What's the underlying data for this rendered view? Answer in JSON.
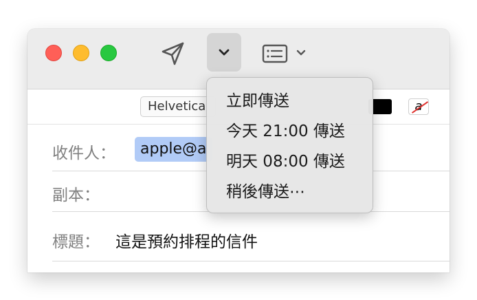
{
  "toolbar": {
    "font_name": "Helvetica",
    "text_color": "#000000",
    "background_color_glyph": "a"
  },
  "fields": {
    "to_label": "收件人：",
    "to_value": "apple@a",
    "cc_label": "副本：",
    "subject_label": "標題：",
    "subject_value": "這是預約排程的信件"
  },
  "send_menu": {
    "items": [
      {
        "label": "立即傳送"
      },
      {
        "label": "今天 21:00 傳送"
      },
      {
        "label": "明天 08:00 傳送"
      },
      {
        "label": "稍後傳送⋯"
      }
    ]
  },
  "icons": {
    "send": "paper-plane-icon",
    "send_options": "chevron-down-icon",
    "header_fields": "header-fields-icon"
  },
  "colors": {
    "close": "#ff5f57",
    "minimize": "#febc2e",
    "zoom": "#28c840",
    "recipient_highlight": "#b1cbf7"
  }
}
